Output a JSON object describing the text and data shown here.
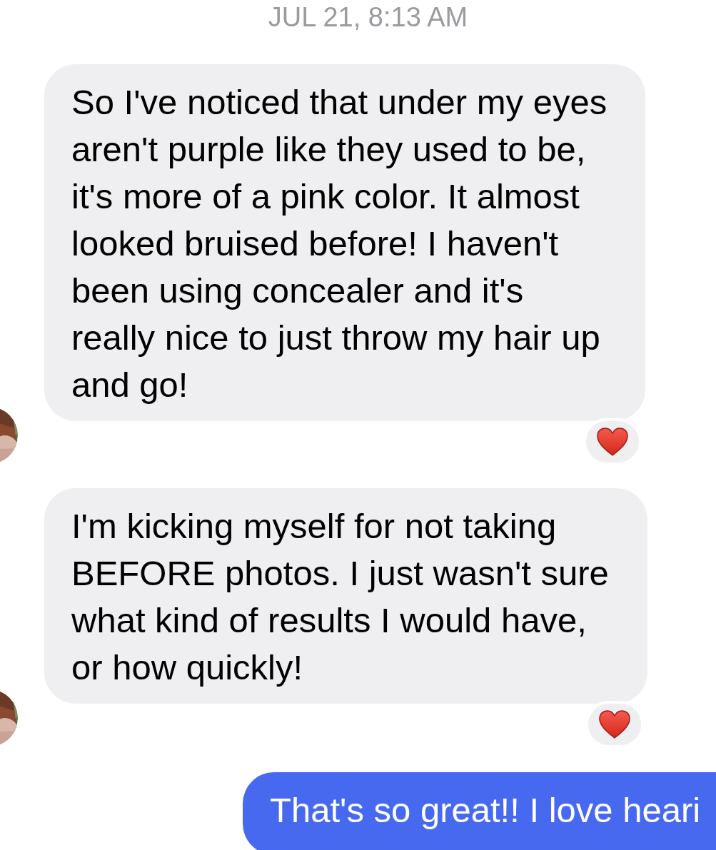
{
  "timestamp": "JUL 21, 8:13 AM",
  "messages": [
    {
      "kind": "incoming",
      "text": "So I've noticed that under my eyes\naren't purple like they used to be,\nit's more of a pink color. It almost\nlooked bruised before! I haven't\nbeen using concealer and it's\nreally nice to just throw my hair up\nand go!",
      "reacted": true
    },
    {
      "kind": "incoming",
      "text": "I'm kicking myself for not taking\nBEFORE photos. I just wasn't sure\nwhat kind of results I would have,\nor how quickly!",
      "reacted": true
    },
    {
      "kind": "outgoing",
      "text": "That's so great!! I love heari",
      "reacted": false
    }
  ]
}
